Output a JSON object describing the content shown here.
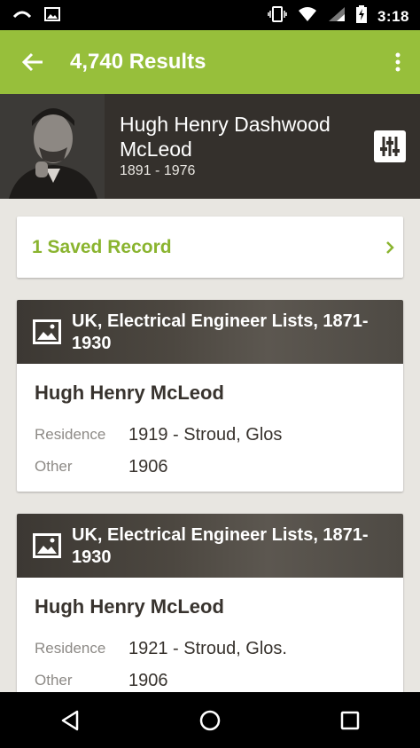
{
  "status_bar": {
    "time": "3:18",
    "icons": [
      "cast-icon",
      "image-icon",
      "vibrate-icon",
      "wifi-icon",
      "signal-icon",
      "battery-charging-icon"
    ]
  },
  "app_bar": {
    "title": "4,740 Results",
    "back_icon": "arrow-left-icon",
    "menu_icon": "more-vertical-icon"
  },
  "person": {
    "name": "Hugh Henry Dashwood McLeod",
    "dates": "1891 - 1976",
    "filter_icon": "filter-sliders-icon"
  },
  "saved_records": {
    "label": "1 Saved Record"
  },
  "records": [
    {
      "collection": "UK, Electrical Engineer Lists, 1871-1930",
      "name": "Hugh Henry McLeod",
      "fields": [
        {
          "key": "Residence",
          "value": "1919 - Stroud, Glos"
        },
        {
          "key": "Other",
          "value": "1906"
        }
      ]
    },
    {
      "collection": "UK, Electrical Engineer Lists, 1871-1930",
      "name": "Hugh Henry McLeod",
      "fields": [
        {
          "key": "Residence",
          "value": "1921 - Stroud, Glos."
        },
        {
          "key": "Other",
          "value": "1906"
        }
      ]
    }
  ],
  "colors": {
    "accent": "#97bf3b",
    "accent_text": "#8ab42f",
    "header_dark": "#34302c",
    "background": "#e8e6e1"
  }
}
